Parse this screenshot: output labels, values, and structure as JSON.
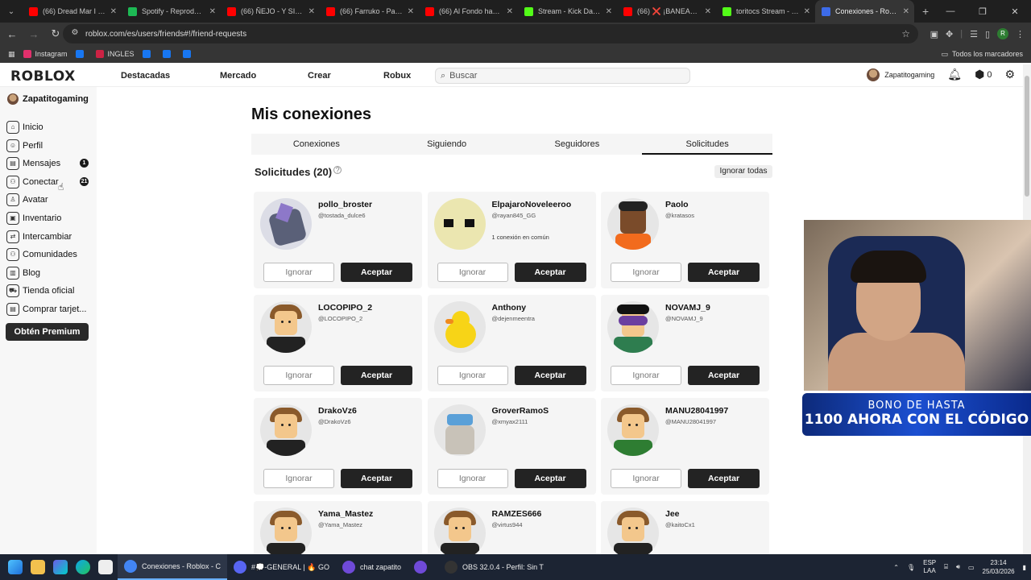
{
  "browser": {
    "tabs": [
      {
        "title": "(66) Dread Mar I - Tu",
        "color": "#ff0000"
      },
      {
        "title": "Spotify - Reproductor",
        "color": "#1db954"
      },
      {
        "title": "(66) ÑEJO - Y SI LA V",
        "color": "#ff0000"
      },
      {
        "title": "(66) Farruko - Passion",
        "color": "#ff0000"
      },
      {
        "title": "(66) Al Fondo hay Sit",
        "color": "#ff0000"
      },
      {
        "title": "Stream - Kick Dashbo",
        "color": "#53fc18"
      },
      {
        "title": "(66) ❌ ¡BANEARON",
        "color": "#ff0000"
      },
      {
        "title": "toritocs Stream - Wa",
        "color": "#53fc18"
      },
      {
        "title": "Conexiones - Roblox",
        "color": "#3d6be8"
      }
    ],
    "url": "roblox.com/es/users/friends#!/friend-requests",
    "profile_initial": "R",
    "bookmarks": [
      {
        "label": "Instagram",
        "color": "#e1306c"
      },
      {
        "label": "",
        "color": "#1877f2"
      },
      {
        "label": "INGLES",
        "color": "#cc2244"
      },
      {
        "label": "",
        "color": "#1877f2"
      },
      {
        "label": "",
        "color": "#1877f2"
      },
      {
        "label": "",
        "color": "#1877f2"
      }
    ],
    "all_bookmarks": "Todos los marcadores"
  },
  "header": {
    "logo": "ROBLOX",
    "nav": [
      "Destacadas",
      "Mercado",
      "Crear",
      "Robux"
    ],
    "search_placeholder": "Buscar",
    "username": "Zapatitogaming",
    "robux": "0"
  },
  "sidebar": {
    "username": "Zapatitogaming",
    "items": [
      {
        "label": "Inicio",
        "icon": "home-icon",
        "badge": ""
      },
      {
        "label": "Perfil",
        "icon": "profile-icon",
        "badge": ""
      },
      {
        "label": "Mensajes",
        "icon": "messages-icon",
        "badge": "1"
      },
      {
        "label": "Conectar",
        "icon": "connect-icon",
        "badge": "21"
      },
      {
        "label": "Avatar",
        "icon": "avatar-icon",
        "badge": ""
      },
      {
        "label": "Inventario",
        "icon": "inventory-icon",
        "badge": ""
      },
      {
        "label": "Intercambiar",
        "icon": "trade-icon",
        "badge": ""
      },
      {
        "label": "Comunidades",
        "icon": "communities-icon",
        "badge": ""
      },
      {
        "label": "Blog",
        "icon": "blog-icon",
        "badge": ""
      },
      {
        "label": "Tienda oficial",
        "icon": "store-icon",
        "badge": ""
      },
      {
        "label": "Comprar tarjet...",
        "icon": "gift-card-icon",
        "badge": ""
      }
    ],
    "premium": "Obtén Premium"
  },
  "main": {
    "title": "Mis conexiones",
    "tabs": [
      "Conexiones",
      "Siguiendo",
      "Seguidores",
      "Solicitudes"
    ],
    "active_tab": 3,
    "requests_title": "Solicitudes (20)",
    "ignore_all": "Ignorar todas",
    "ignore_label": "Ignorar",
    "accept_label": "Aceptar",
    "cards": [
      {
        "name": "pollo_broster",
        "handle": "@tostada_dulce6",
        "mutual": ""
      },
      {
        "name": "ElpajaroNoveleeroo",
        "handle": "@rayan845_GG",
        "mutual": "1 conexión en común"
      },
      {
        "name": "Paolo",
        "handle": "@kratasos",
        "mutual": ""
      },
      {
        "name": "LOCOPIPO_2",
        "handle": "@LOCOPIPO_2",
        "mutual": ""
      },
      {
        "name": "Anthony",
        "handle": "@dejenmeentra",
        "mutual": ""
      },
      {
        "name": "NOVAMJ_9",
        "handle": "@NOVAMJ_9",
        "mutual": ""
      },
      {
        "name": "DrakoVz6",
        "handle": "@DrakoVz6",
        "mutual": ""
      },
      {
        "name": "GroverRamoS",
        "handle": "@xmyax2111",
        "mutual": ""
      },
      {
        "name": "MANU28041997",
        "handle": "@MANU28041997",
        "mutual": ""
      },
      {
        "name": "Yama_Mastez",
        "handle": "@Yama_Mastez",
        "mutual": ""
      },
      {
        "name": "RAMZES666",
        "handle": "@virtus944",
        "mutual": ""
      },
      {
        "name": "Jee",
        "handle": "@kaitoCx1",
        "mutual": ""
      }
    ]
  },
  "overlay": {
    "promo_line1": "BONO DE HASTA",
    "promo_line2": "1100 AHORA CON EL CÓDIGO"
  },
  "taskbar": {
    "apps": [
      {
        "label": "Conexiones - Roblox - C",
        "active": true
      },
      {
        "label": "#💭-GENERAL | 🔥 GO",
        "active": false
      },
      {
        "label": "chat zapatito",
        "active": false
      },
      {
        "label": "",
        "active": false
      },
      {
        "label": "OBS 32.0.4 - Perfil: Sin T",
        "active": false
      }
    ],
    "lang_top": "ESP",
    "lang_bottom": "LAA",
    "time": "23:14",
    "date": "25/03/2026"
  }
}
